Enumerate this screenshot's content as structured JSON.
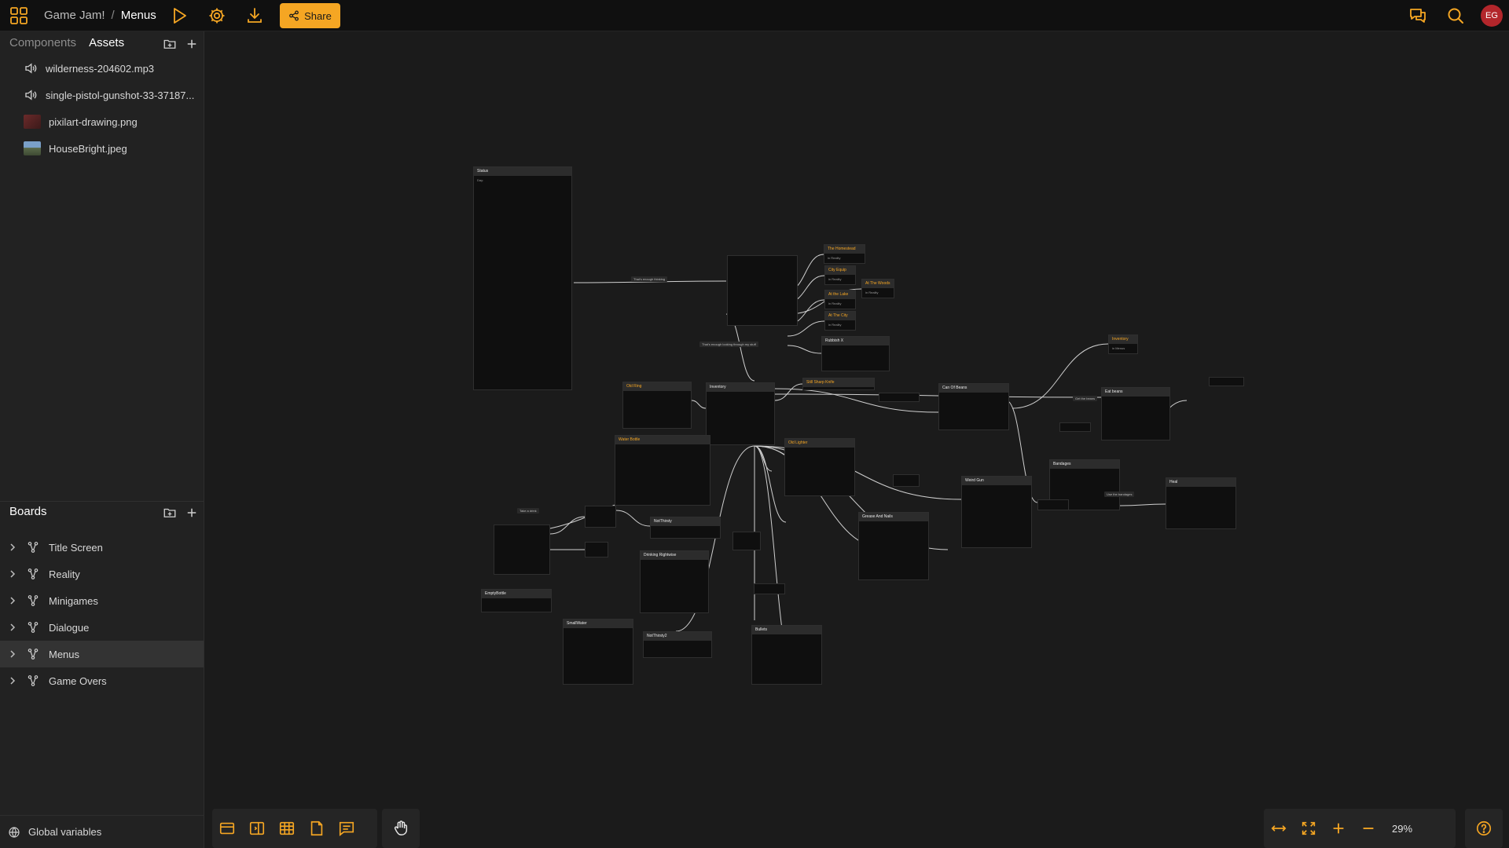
{
  "colors": {
    "accent": "#f5a623",
    "topbar_bg": "#101010",
    "sidebar_bg": "#222222",
    "canvas_bg": "#1b1b1b",
    "avatar_bg": "#b3262b"
  },
  "topbar": {
    "app_icon": "grid-icon",
    "project": "Game Jam!",
    "separator": "/",
    "board": "Menus",
    "play_icon": "play-icon",
    "settings_icon": "gear-icon",
    "download_icon": "download-icon",
    "share_label": "Share",
    "comments_icon": "comments-icon",
    "search_icon": "search-icon",
    "avatar_initials": "EG"
  },
  "sidebar": {
    "tabs": [
      {
        "label": "Components"
      },
      {
        "label": "Assets"
      }
    ],
    "active_tab": "Assets",
    "assets": [
      {
        "name": "wilderness-204602.mp3",
        "icon": "audio-icon"
      },
      {
        "name": "single-pistol-gunshot-33-37187...",
        "icon": "audio-icon"
      },
      {
        "name": "pixilart-drawing.png",
        "icon": "image-thumbnail"
      },
      {
        "name": "HouseBright.jpeg",
        "icon": "image-thumbnail"
      }
    ],
    "boards_title": "Boards",
    "boards": [
      {
        "label": "Title Screen"
      },
      {
        "label": "Reality"
      },
      {
        "label": "Minigames"
      },
      {
        "label": "Dialogue"
      },
      {
        "label": "Menus"
      },
      {
        "label": "Game Overs"
      }
    ],
    "active_board": "Menus",
    "global_variables_label": "Global variables"
  },
  "canvas": {
    "nodes": [
      {
        "title": "Status",
        "text": "Day:"
      },
      {
        "title": "The Homestead",
        "text": "in Reality"
      },
      {
        "title": "City Equip",
        "text": "in Reality"
      },
      {
        "title": "At The Woods",
        "text": "in Reality"
      },
      {
        "title": "At the Lake",
        "text": "in Reality"
      },
      {
        "title": "At The City",
        "text": "in Reality"
      },
      {
        "title": "Rubbish X",
        "text": ""
      },
      {
        "title": "Old Ring",
        "text": ""
      },
      {
        "title": "Inventory",
        "text": ""
      },
      {
        "title": "Still Sharp Knife",
        "text": ""
      },
      {
        "title": "Can Of Beans",
        "text": ""
      },
      {
        "title": "Inventory",
        "text": "in Menus"
      },
      {
        "title": "Eat beans",
        "text": ""
      },
      {
        "title": "Water Bottle",
        "text": ""
      },
      {
        "title": "Old Lighter",
        "text": ""
      },
      {
        "title": "Weird Gun",
        "text": ""
      },
      {
        "title": "Bandages",
        "text": ""
      },
      {
        "title": "Heal",
        "text": ""
      },
      {
        "title": "Grease And Nails",
        "text": ""
      },
      {
        "title": "NotThirsty",
        "text": ""
      },
      {
        "title": "Drinking Rightwise",
        "text": ""
      },
      {
        "title": "EmptyBottle",
        "text": ""
      },
      {
        "title": "SmallWater",
        "text": ""
      },
      {
        "title": "NotThirsty2",
        "text": ""
      },
      {
        "title": "Bullets",
        "text": ""
      }
    ],
    "wire_labels": [
      "That's enough thinking",
      "That's enough looking through my stuff",
      "Take a drink",
      "Use the bandages",
      "Get the beans"
    ]
  },
  "bottom_left_tools": [
    {
      "icon": "card-icon"
    },
    {
      "icon": "sidebar-panel-icon"
    },
    {
      "icon": "table-icon"
    },
    {
      "icon": "page-icon"
    },
    {
      "icon": "comment-icon"
    },
    {
      "icon": "hand-icon"
    }
  ],
  "bottom_right_tools": [
    {
      "icon": "fit-width-icon"
    },
    {
      "icon": "fullscreen-icon"
    },
    {
      "icon": "zoom-in-icon"
    },
    {
      "icon": "zoom-out-icon"
    }
  ],
  "zoom": "29%",
  "help_icon": "help-icon"
}
